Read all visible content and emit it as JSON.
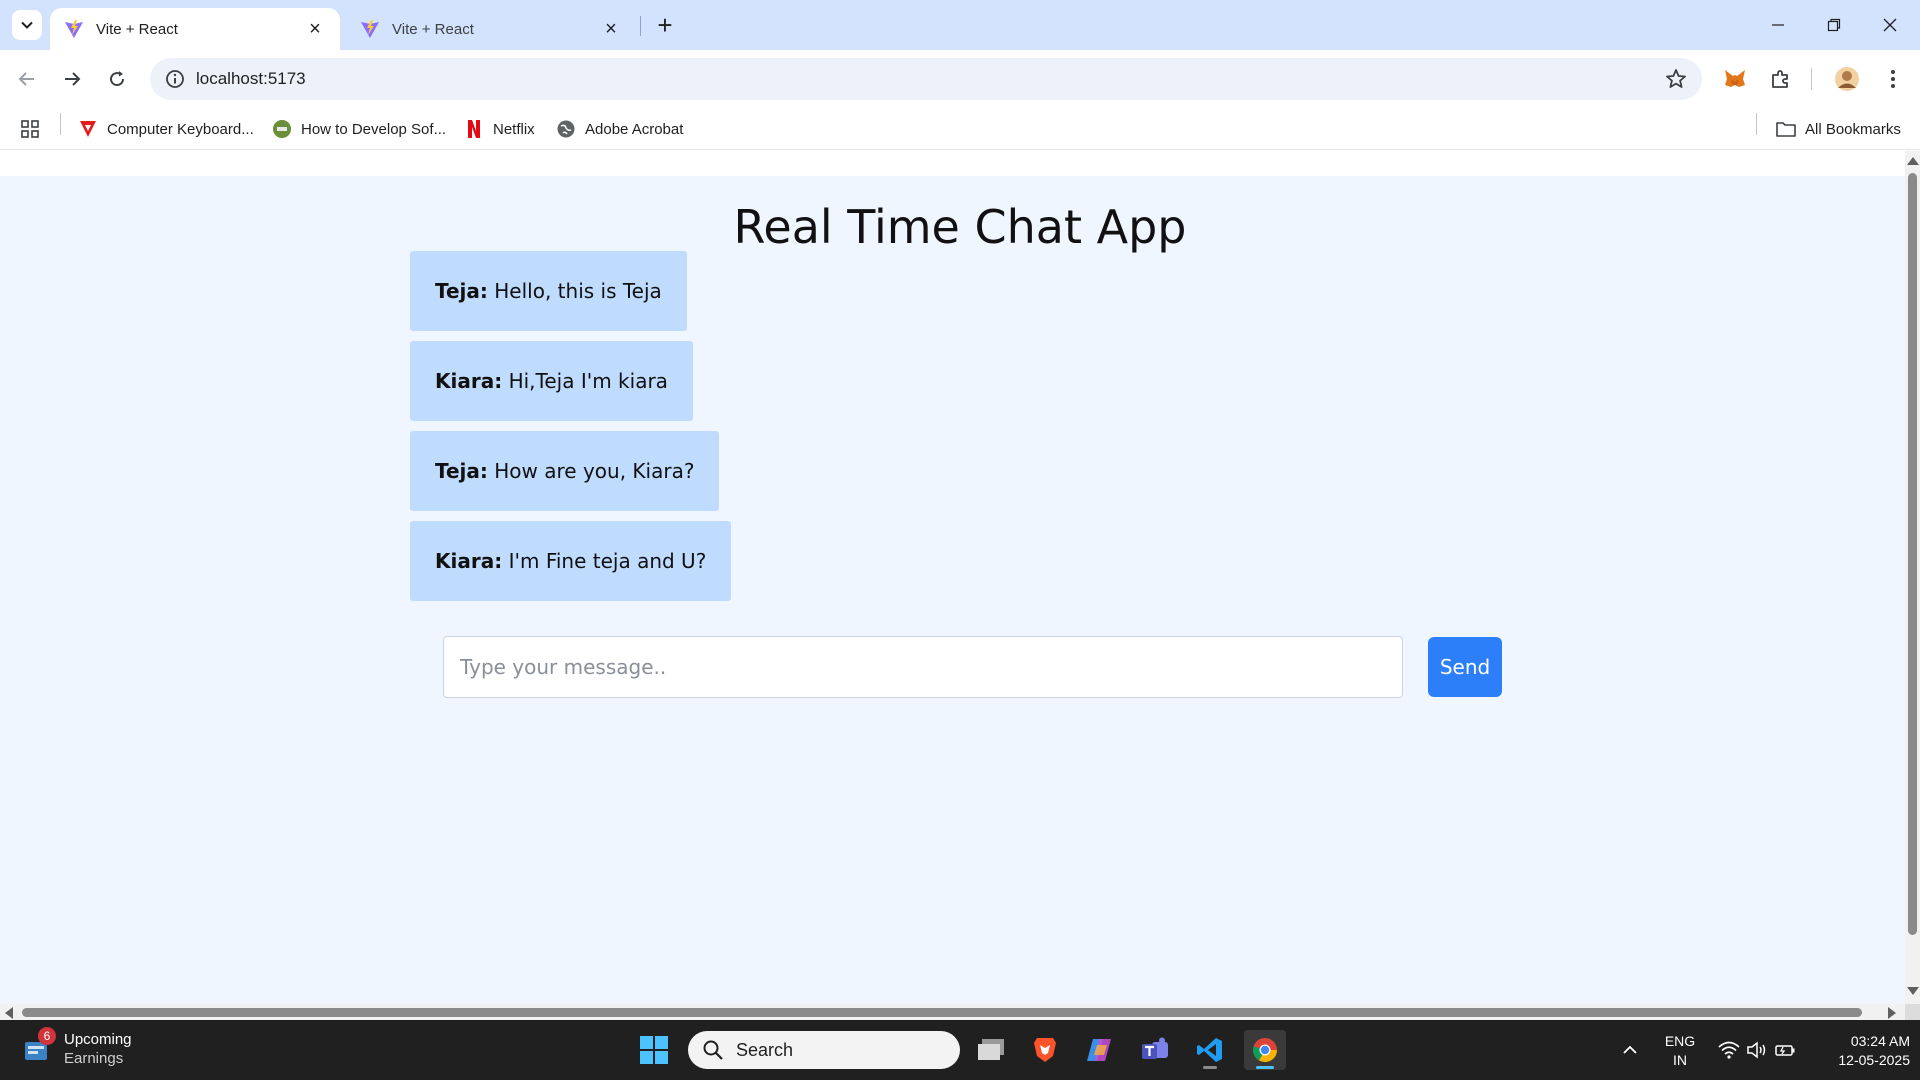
{
  "browser": {
    "tabs": [
      {
        "title": "Vite + React",
        "active": true
      },
      {
        "title": "Vite + React",
        "active": false
      }
    ],
    "url": "localhost:5173",
    "bookmarks": [
      {
        "label": "Computer Keyboard...",
        "icon": "tubi-icon"
      },
      {
        "label": "How to Develop Sof...",
        "icon": "site-icon"
      },
      {
        "label": "Netflix",
        "icon": "netflix-icon"
      },
      {
        "label": "Adobe Acrobat",
        "icon": "globe-icon"
      }
    ],
    "all_bookmarks_label": "All Bookmarks"
  },
  "app": {
    "title": "Real Time Chat App",
    "messages": [
      {
        "sender": "Teja:",
        "text": "Hello, this is Teja"
      },
      {
        "sender": "Kiara:",
        "text": "Hi,Teja I'm kiara"
      },
      {
        "sender": "Teja:",
        "text": "How are you, Kiara?"
      },
      {
        "sender": "Kiara:",
        "text": "I'm Fine teja and U?"
      }
    ],
    "input": {
      "placeholder": "Type your message..",
      "value": ""
    },
    "send_label": "Send",
    "colors": {
      "bubble": "#bfdbfe",
      "page_bg": "#eff6ff",
      "send_button": "#2d7ff9"
    }
  },
  "taskbar": {
    "news": {
      "badge": "6",
      "title": "Upcoming",
      "subtitle": "Earnings"
    },
    "search_placeholder": "Search",
    "apps": [
      "task-view-icon",
      "brave-icon",
      "copilot-icon",
      "teams-icon",
      "vscode-icon",
      "chrome-icon"
    ],
    "language": {
      "line1": "ENG",
      "line2": "IN"
    },
    "time": "03:24 AM",
    "date": "12-05-2025"
  }
}
